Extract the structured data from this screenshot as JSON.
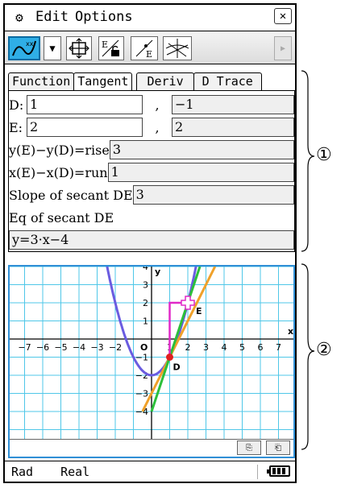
{
  "menu": {
    "gear": "⚙",
    "edit": "Edit",
    "options": "Options",
    "close": "✕"
  },
  "toolbar": {
    "dropdown": "▼",
    "scroll": "▶"
  },
  "tabs": [
    "Function",
    "Tangent",
    "Deriv",
    "D Trace"
  ],
  "fields": {
    "d_label": "D:",
    "d_x": "1",
    "d_y": "−1",
    "e_label": "E:",
    "e_x": "2",
    "e_y": "2",
    "comma": ",",
    "rise_label": "y(E)−y(D)=rise",
    "rise_value": "3",
    "run_label": "x(E)−x(D)=run",
    "run_value": "1",
    "slope_label": "Slope of secant DE",
    "slope_value": "3",
    "eq_label": "Eq of secant DE",
    "eq_value": "y=3·x−4"
  },
  "graph": {
    "x_axis_label": "x",
    "y_axis_label": "y",
    "origin": "O",
    "point_d": "D",
    "point_e": "E",
    "x_ticks": [
      "−7",
      "−6",
      "−5",
      "−4",
      "−3",
      "−2",
      "1",
      "2",
      "3",
      "4",
      "5",
      "6",
      "7"
    ],
    "y_ticks": [
      "4",
      "3",
      "2",
      "1",
      "−1",
      "−2",
      "−3",
      "−4"
    ],
    "colors": {
      "grid": "#4fc7e8",
      "parabola": "#6a5ce0",
      "tangent": "#f0a12a",
      "secant": "#2cbf3a",
      "rise_run": "#e028c8",
      "point": "#e02020"
    }
  },
  "status": {
    "angle": "Rad",
    "mode": "Real"
  },
  "annotations": {
    "one": "①",
    "two": "②"
  }
}
